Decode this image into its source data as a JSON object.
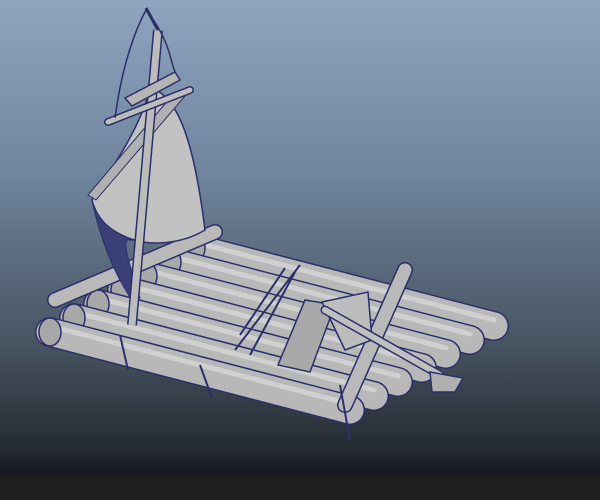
{
  "viewport": {
    "background_top": "#8fa4bf",
    "background_bottom": "#242a31",
    "model_color": "#b8b8b8",
    "wireframe_color": "#2b2f6a"
  }
}
